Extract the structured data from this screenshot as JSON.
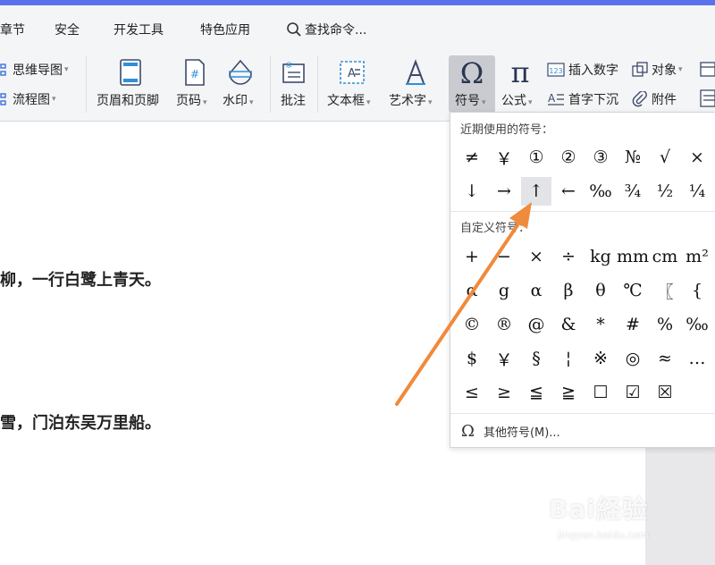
{
  "menubar": {
    "items": [
      "章节",
      "安全",
      "开发工具",
      "特色应用"
    ],
    "search_label": "查找命令..."
  },
  "ribbon": {
    "mindmap": "思维导图",
    "flowchart": "流程图",
    "header_footer": "页眉和页脚",
    "page_number": "页码",
    "watermark": "水印",
    "comment": "批注",
    "textbox": "文本框",
    "wordart": "艺术字",
    "symbol": "符号",
    "formula": "公式",
    "insert_number": "插入数字",
    "object": "对象",
    "dropcap": "首字下沉",
    "attachment": "附件"
  },
  "document": {
    "line1": "柳，一行白鹭上青天。",
    "line2": "雪，门泊东吴万里船。"
  },
  "symbol_panel": {
    "recent_title": "近期使用的符号：",
    "recent": [
      "≠",
      "￥",
      "①",
      "②",
      "③",
      "№",
      "√",
      "×",
      "↓",
      "→",
      "↑",
      "←",
      "‰",
      "¾",
      "½",
      "¼"
    ],
    "custom_title": "自定义符号：",
    "custom": [
      "+",
      "−",
      "×",
      "÷",
      "kg",
      "mm",
      "cm",
      "m²",
      "α",
      "g",
      "α",
      "β",
      "θ",
      "℃",
      "〖",
      "{",
      "©",
      "®",
      "@",
      "&",
      "*",
      "#",
      "%",
      "‰",
      "$",
      "￥",
      "§",
      "¦",
      "※",
      "◎",
      "≈",
      "…",
      "≤",
      "≥",
      "≦",
      "≧",
      "☐",
      "☑",
      "☒"
    ],
    "more_label": "其他符号(M)..."
  },
  "watermark": {
    "text": "Bai経验",
    "url": "jingyan.baidu.com"
  },
  "colors": {
    "accent": "#5a73ea",
    "annotation_arrow": "#f08a3c"
  }
}
